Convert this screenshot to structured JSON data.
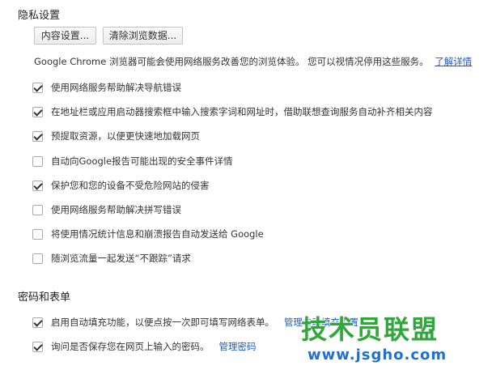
{
  "privacy": {
    "title": "隐私设置",
    "content_settings_button": "内容设置...",
    "clear_data_button": "清除浏览数据...",
    "description": "Google Chrome 浏览器可能会使用网络服务改善您的浏览体验。 您可以视情况停用这些服务。",
    "learn_more": "了解详情",
    "options": [
      {
        "label": "使用网络服务帮助解决导航错误",
        "checked": true
      },
      {
        "label": "在地址栏或应用启动器搜索框中输入搜索字词和网址时，借助联想查询服务自动补齐相关内容",
        "checked": true
      },
      {
        "label": "预提取资源，以便更快速地加载网页",
        "checked": true
      },
      {
        "label": "自动向Google报告可能出现的安全事件详情",
        "checked": false
      },
      {
        "label": "保护您和您的设备不受危险网站的侵害",
        "checked": true
      },
      {
        "label": "使用网络服务帮助解决拼写错误",
        "checked": false
      },
      {
        "label": "将使用情况统计信息和崩溃报告自动发送给 Google",
        "checked": false
      },
      {
        "label": "随浏览流量一起发送“不跟踪”请求",
        "checked": false
      }
    ]
  },
  "passwords": {
    "title": "密码和表单",
    "autofill_label": "启用自动填充功能，以便点按一次即可填写网络表单。",
    "autofill_checked": true,
    "autofill_link": "管理自动填充设置",
    "save_passwords_label": "询问是否保存您在网页上输入的密码。",
    "save_passwords_checked": true,
    "manage_passwords_link": "管理密码"
  },
  "watermark": {
    "brand": "技术员联盟",
    "url": "www.jsgho.com"
  },
  "colors": {
    "link": "#1a57c8",
    "watermark_green": "#2fa83a",
    "watermark_blue": "#1f6fd1"
  }
}
